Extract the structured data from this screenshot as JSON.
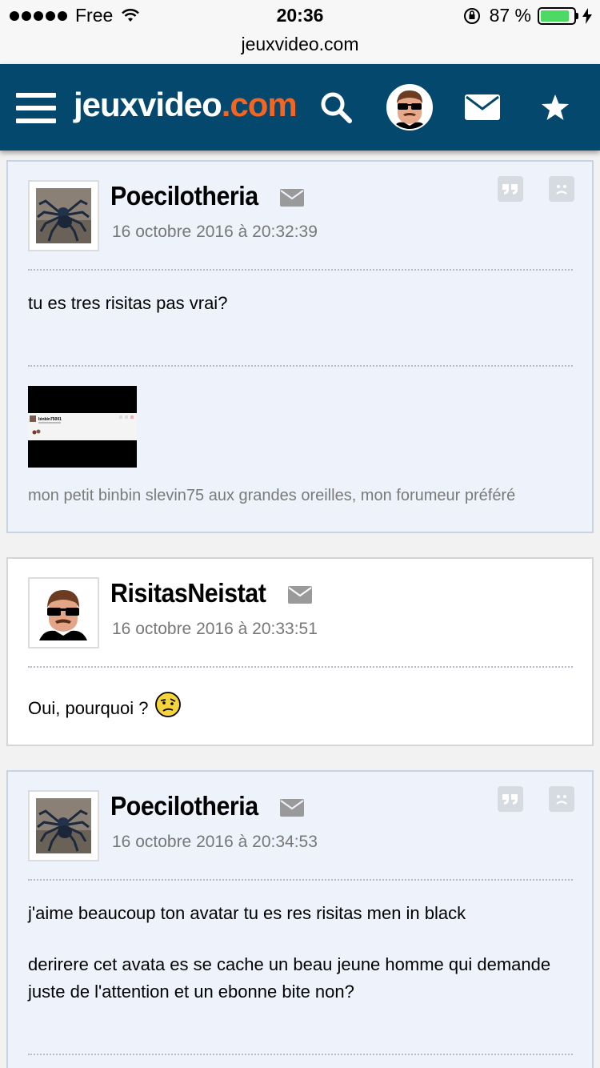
{
  "status_bar": {
    "carrier": "Free",
    "time": "20:36",
    "battery": "87 %",
    "battery_level": 0.87
  },
  "url_bar": {
    "domain": "jeuxvideo.com"
  },
  "header": {
    "logo_main": "jeuxvideo",
    "logo_accent": ".com",
    "icons": [
      "menu-icon",
      "search-icon",
      "user-avatar",
      "mail-icon",
      "star-icon"
    ],
    "colors": {
      "bar": "#05486d",
      "accent": "#f26522"
    }
  },
  "posts": [
    {
      "author": "Poecilotheria",
      "date": "16 octobre 2016 à 20:32:39",
      "body": [
        "tu es tres risitas pas vrai?"
      ],
      "signature": "mon petit binbin slevin75 aux grandes oreilles, mon forumeur préféré",
      "signature_thumb_name": "binbin75001"
    },
    {
      "author": "RisitasNeistat",
      "date": "16 octobre 2016 à 20:33:51",
      "body": [
        "Oui, pourquoi ?"
      ],
      "smiley": "doubt-smiley"
    },
    {
      "author": "Poecilotheria",
      "date": "16 octobre 2016 à 20:34:53",
      "body": [
        "j'aime beaucoup ton avatar tu es res risitas men in black",
        "derirere cet avata es se cache un beau jeune homme qui demande juste de l'attention et un ebonne bite non?"
      ]
    }
  ]
}
